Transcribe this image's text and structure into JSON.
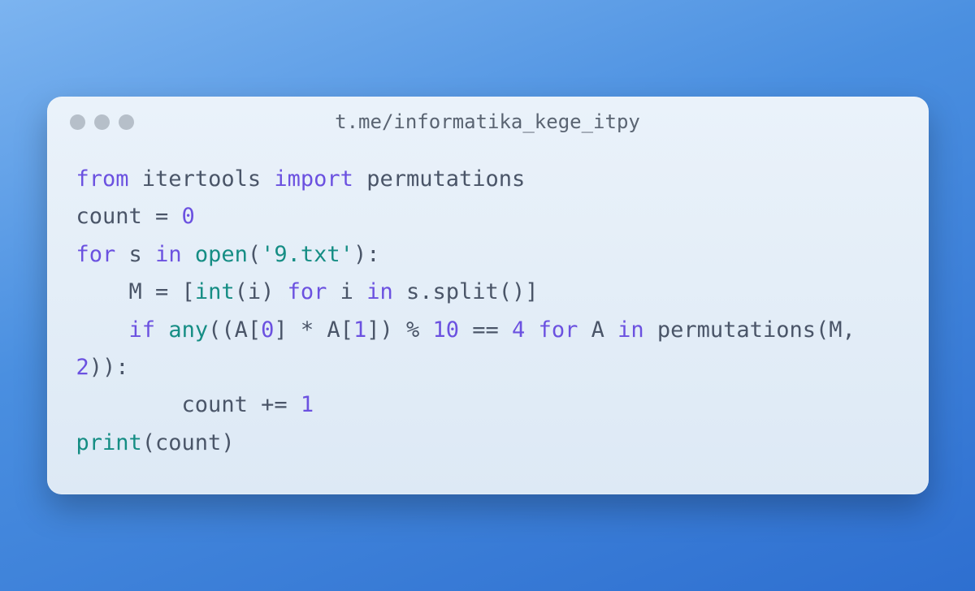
{
  "window": {
    "title": "t.me/informatika_kege_itpy"
  },
  "code": {
    "tokens": [
      {
        "t": "from",
        "c": "kw"
      },
      {
        "t": " "
      },
      {
        "t": "itertools",
        "c": "name"
      },
      {
        "t": " "
      },
      {
        "t": "import",
        "c": "kw"
      },
      {
        "t": " "
      },
      {
        "t": "permutations",
        "c": "name"
      },
      {
        "t": "\n"
      },
      {
        "t": "count = ",
        "c": "name"
      },
      {
        "t": "0",
        "c": "num"
      },
      {
        "t": "\n"
      },
      {
        "t": "for",
        "c": "kw"
      },
      {
        "t": " s ",
        "c": "name"
      },
      {
        "t": "in",
        "c": "kw"
      },
      {
        "t": " "
      },
      {
        "t": "open",
        "c": "fn"
      },
      {
        "t": "(",
        "c": "name"
      },
      {
        "t": "'9.txt'",
        "c": "str"
      },
      {
        "t": "):",
        "c": "name"
      },
      {
        "t": "\n"
      },
      {
        "t": "    M = [",
        "c": "name"
      },
      {
        "t": "int",
        "c": "fn"
      },
      {
        "t": "(i) ",
        "c": "name"
      },
      {
        "t": "for",
        "c": "kw"
      },
      {
        "t": " i ",
        "c": "name"
      },
      {
        "t": "in",
        "c": "kw"
      },
      {
        "t": " s.split()]",
        "c": "name"
      },
      {
        "t": "\n"
      },
      {
        "t": "    ",
        "c": "name"
      },
      {
        "t": "if",
        "c": "kw"
      },
      {
        "t": " ",
        "c": "name"
      },
      {
        "t": "any",
        "c": "fn"
      },
      {
        "t": "((A[",
        "c": "name"
      },
      {
        "t": "0",
        "c": "num"
      },
      {
        "t": "] * A[",
        "c": "name"
      },
      {
        "t": "1",
        "c": "num"
      },
      {
        "t": "]) % ",
        "c": "name"
      },
      {
        "t": "10",
        "c": "num"
      },
      {
        "t": " == ",
        "c": "name"
      },
      {
        "t": "4",
        "c": "num"
      },
      {
        "t": " ",
        "c": "name"
      },
      {
        "t": "for",
        "c": "kw"
      },
      {
        "t": " A ",
        "c": "name"
      },
      {
        "t": "in",
        "c": "kw"
      },
      {
        "t": " permutations(M, ",
        "c": "name"
      },
      {
        "t": "2",
        "c": "num"
      },
      {
        "t": ")):",
        "c": "name"
      },
      {
        "t": "\n"
      },
      {
        "t": "        count += ",
        "c": "name"
      },
      {
        "t": "1",
        "c": "num"
      },
      {
        "t": "\n"
      },
      {
        "t": "print",
        "c": "fn"
      },
      {
        "t": "(count)",
        "c": "name"
      }
    ],
    "plain": "from itertools import permutations\ncount = 0\nfor s in open('9.txt'):\n    M = [int(i) for i in s.split()]\n    if any((A[0] * A[1]) % 10 == 4 for A in permutations(M, 2)):\n        count += 1\nprint(count)"
  }
}
